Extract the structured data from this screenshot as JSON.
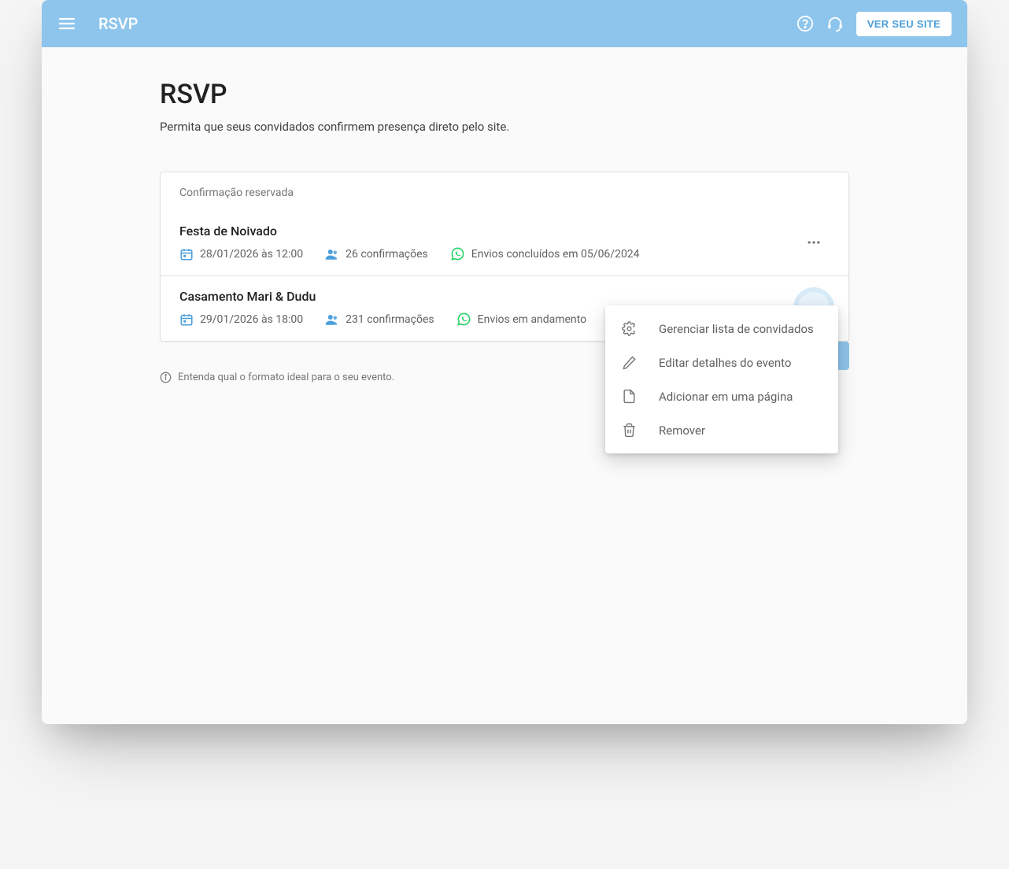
{
  "header": {
    "app_title": "RSVP",
    "view_site_label": "VER SEU SITE"
  },
  "page": {
    "title": "RSVP",
    "subtitle": "Permita que seus convidados confirmem presença direto pelo site."
  },
  "card": {
    "section_label": "Confirmação reservada"
  },
  "events": [
    {
      "title": "Festa de Noivado",
      "date_text": "28/01/2026 às 12:00",
      "confirmations_text": "26 confirmações",
      "status_text": "Envios concluídos em 05/06/2024"
    },
    {
      "title": "Casamento Mari & Dudu",
      "date_text": "29/01/2026 às 18:00",
      "confirmations_text": "231 confirmações",
      "status_text": "Envios em andamento"
    }
  ],
  "menu": {
    "items": [
      {
        "label": "Gerenciar lista de convidados",
        "icon": "gear"
      },
      {
        "label": "Editar detalhes do evento",
        "icon": "pencil"
      },
      {
        "label": "Adicionar em uma página",
        "icon": "document"
      },
      {
        "label": "Remover",
        "icon": "trash"
      }
    ]
  },
  "footer": {
    "hint": "Entenda qual o formato ideal para o seu evento."
  }
}
